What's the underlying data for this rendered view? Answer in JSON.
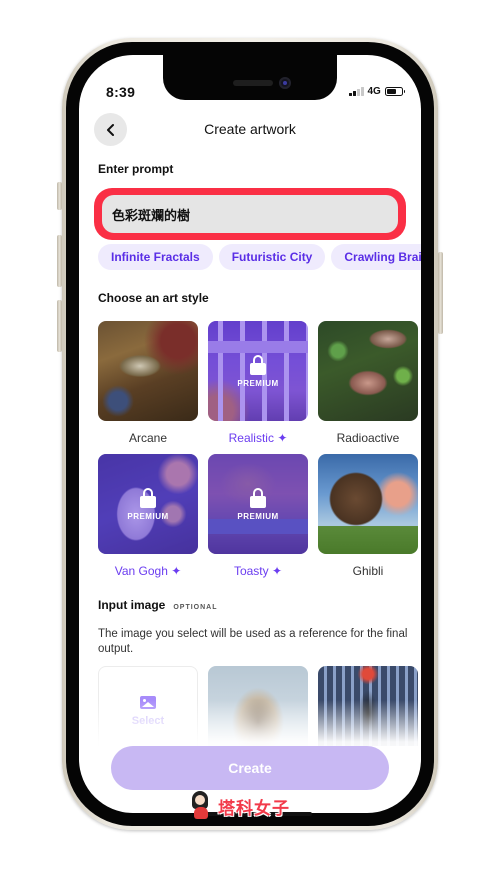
{
  "status_bar": {
    "time": "8:39",
    "network": "4G",
    "signal_bars_active": 2,
    "signal_bars_total": 4,
    "battery_level": 0.7
  },
  "header": {
    "back_icon": "chevron-left-icon",
    "title": "Create artwork"
  },
  "prompt": {
    "label": "Enter prompt",
    "value": "色彩斑斕的樹",
    "highlight_color": "#fa2f45"
  },
  "suggestions": [
    {
      "label": "Infinite Fractals"
    },
    {
      "label": "Futuristic City"
    },
    {
      "label": "Crawling Brains"
    }
  ],
  "art_style": {
    "label": "Choose an art style",
    "premium_text": "PREMIUM",
    "premium_star": "✦",
    "styles": [
      {
        "name": "Arcane",
        "premium": false
      },
      {
        "name": "Realistic",
        "premium": true
      },
      {
        "name": "Radioactive",
        "premium": false
      },
      {
        "name": "Van Gogh",
        "premium": true
      },
      {
        "name": "Toasty",
        "premium": true
      },
      {
        "name": "Ghibli",
        "premium": false
      }
    ]
  },
  "input_image": {
    "label": "Input image",
    "optional_tag": "OPTIONAL",
    "description": "The image you select will be used as a reference for the final output.",
    "select_label": "Select",
    "select_icon": "image-icon",
    "references": [
      {
        "name": "owl"
      },
      {
        "name": "escalator"
      }
    ]
  },
  "actions": {
    "create_label": "Create"
  },
  "watermark": {
    "text": "塔科女子"
  },
  "colors": {
    "accent": "#6b3df0",
    "chip_bg": "#efebfd",
    "create_button": "#c8b8f3"
  }
}
